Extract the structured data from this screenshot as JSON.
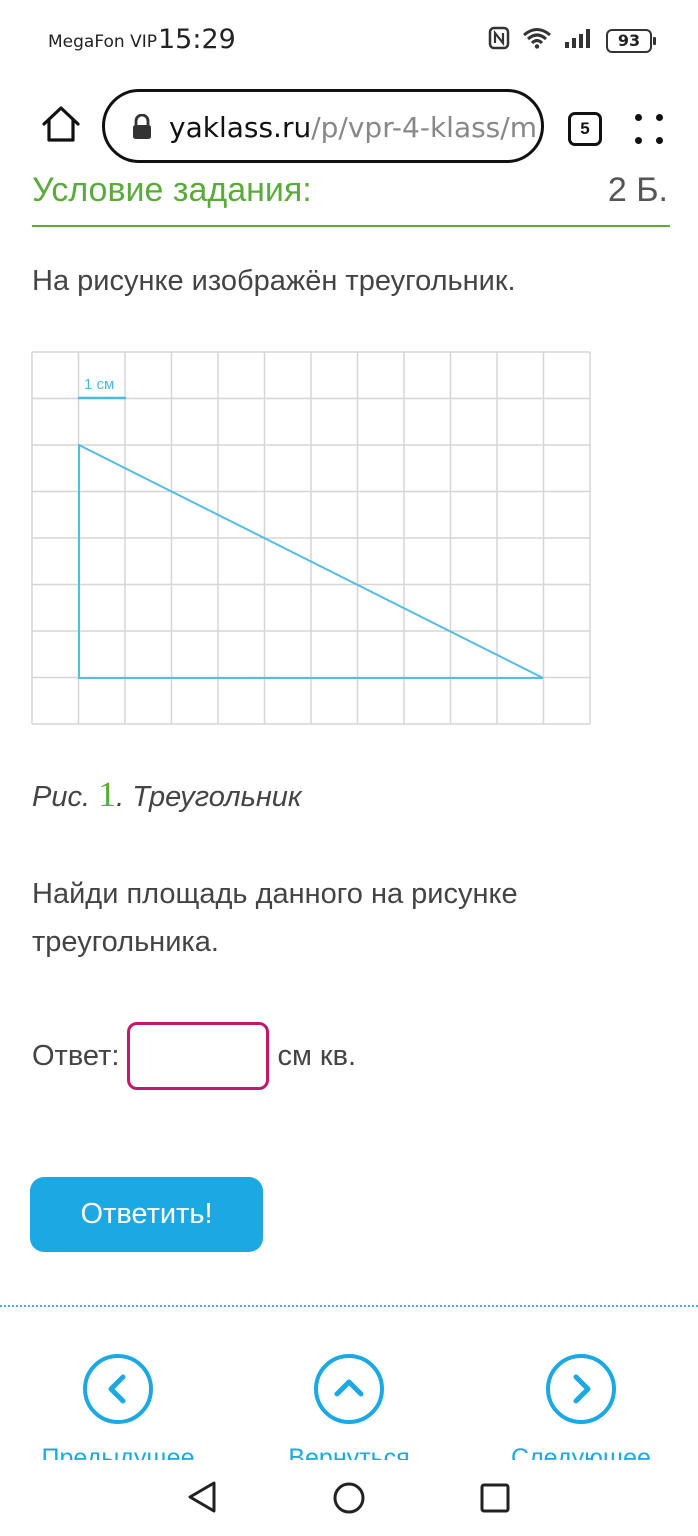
{
  "status_bar": {
    "carrier": "MegaFon VIP",
    "time": "15:29",
    "battery": "93",
    "icons": [
      "nfc-icon",
      "wifi-icon",
      "signal-icon",
      "battery-icon"
    ]
  },
  "browser": {
    "url_domain": "yaklass.ru",
    "url_path": "/p/vpr-4-klass/m",
    "tab_count": "5",
    "icons": [
      "home-icon",
      "lock-icon",
      "tabs-icon",
      "menu-icon"
    ]
  },
  "task": {
    "title": "Условие задания:",
    "points": "2 Б.",
    "intro": "На рисунке изображён треугольник.",
    "figure_scale_label": "1 см",
    "caption_prefix": "Рис.",
    "caption_number": "1",
    "caption_text": ". Треугольник",
    "question": "Найди площадь данного на рисунке треугольника.",
    "answer_label": "Ответ:",
    "answer_value": "",
    "answer_unit": "см кв.",
    "submit_label": "Ответить!"
  },
  "colors": {
    "accent_green": "#5aab3a",
    "accent_blue": "#1ca8e3",
    "input_border": "#c2186b"
  },
  "navigation": {
    "prev_label": "Предыдущее",
    "back_label": "Вернуться",
    "next_label": "Следующее"
  }
}
